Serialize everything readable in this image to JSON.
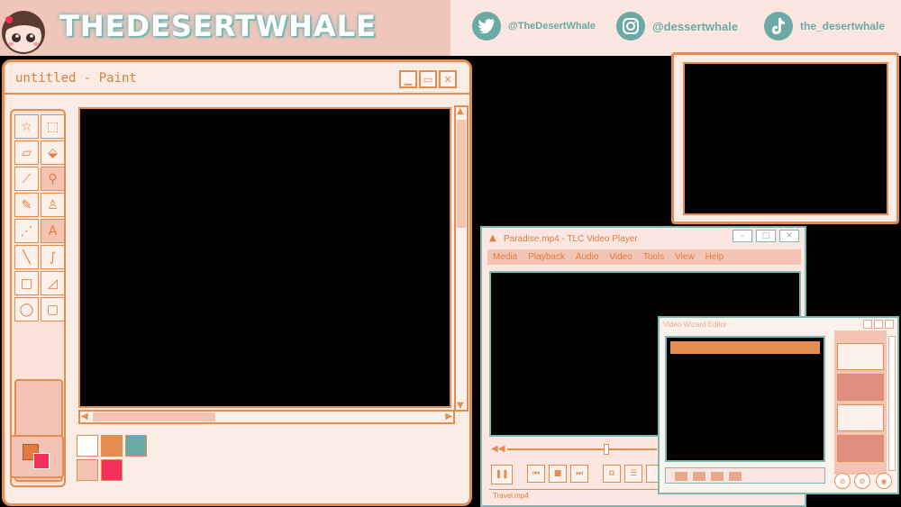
{
  "brand": {
    "title": "THEDESERTWHALE"
  },
  "social": [
    {
      "platform": "twitter-icon",
      "handle": "@TheDesertWhale"
    },
    {
      "platform": "instagram-icon",
      "handle": "@dessertwhale"
    },
    {
      "platform": "tiktok-icon",
      "handle": "the_desertwhale"
    }
  ],
  "paint": {
    "title": "untitled - Paint",
    "tools": [
      "star-select-icon",
      "rect-select-icon",
      "eraser-icon",
      "fill-bucket-icon",
      "color-picker-icon",
      "magnifier-icon",
      "pencil-icon",
      "brush-icon",
      "airbrush-icon",
      "text-icon",
      "line-icon",
      "curve-icon",
      "rectangle-icon",
      "polygon-icon",
      "ellipse-icon",
      "rounded-rect-icon"
    ],
    "text_tool_glyph": "A",
    "palette": [
      "#ffffff",
      "#e58c50",
      "#6ba9a4",
      "#f3c4b4",
      "#f2305a"
    ]
  },
  "video_player": {
    "title": "Paradise.mp4 - TLC Video Player",
    "menu": [
      "Media",
      "Playback",
      "Audio",
      "Video",
      "Tools",
      "View",
      "Help"
    ],
    "status": "Travel.mp4"
  },
  "video_editor": {
    "title": "Video Wizard Editor"
  },
  "colors": {
    "peach": "#f0c6bb",
    "orange": "#e58c50",
    "teal": "#6ba9a4",
    "pink": "#f2305a"
  }
}
